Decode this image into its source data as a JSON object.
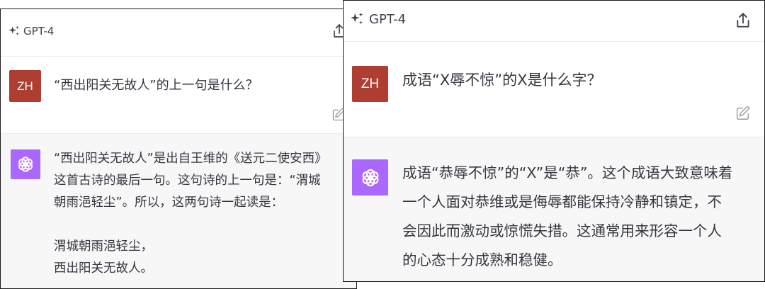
{
  "left": {
    "model_label": "GPT-4",
    "user_initials": "ZH",
    "question": "“西出阳关无故人”的上一句是什么？",
    "answer_lines": [
      "“西出阳关无故人”是出自王维的《送元二使安西》",
      "这首古诗的最后一句。这句诗的上一句是：“渭城",
      "朝雨浥轻尘”。所以，这两句诗一起读是："
    ],
    "poem_lines": [
      "渭城朝雨浥轻尘，",
      "西出阳关无故人。"
    ]
  },
  "right": {
    "model_label": "GPT-4",
    "user_initials": "ZH",
    "question": "成语“X辱不惊”的X是什么字？",
    "answer_lines": [
      "成语“恭辱不惊”的“X”是“恭”。这个成语大致意味着",
      "一个人面对恭维或是侮辱都能保持冷静和镇定，不",
      "会因此而激动或惊慌失措。这通常用来形容一个人",
      "的心态十分成熟和稳健。"
    ]
  },
  "colors": {
    "user_avatar": "#ae3d32",
    "assistant_avatar": "#ab68ff",
    "assistant_bg": "#f7f7f8"
  },
  "icons": [
    "sparkle-icon",
    "share-icon",
    "edit-icon",
    "openai-logo-icon"
  ]
}
